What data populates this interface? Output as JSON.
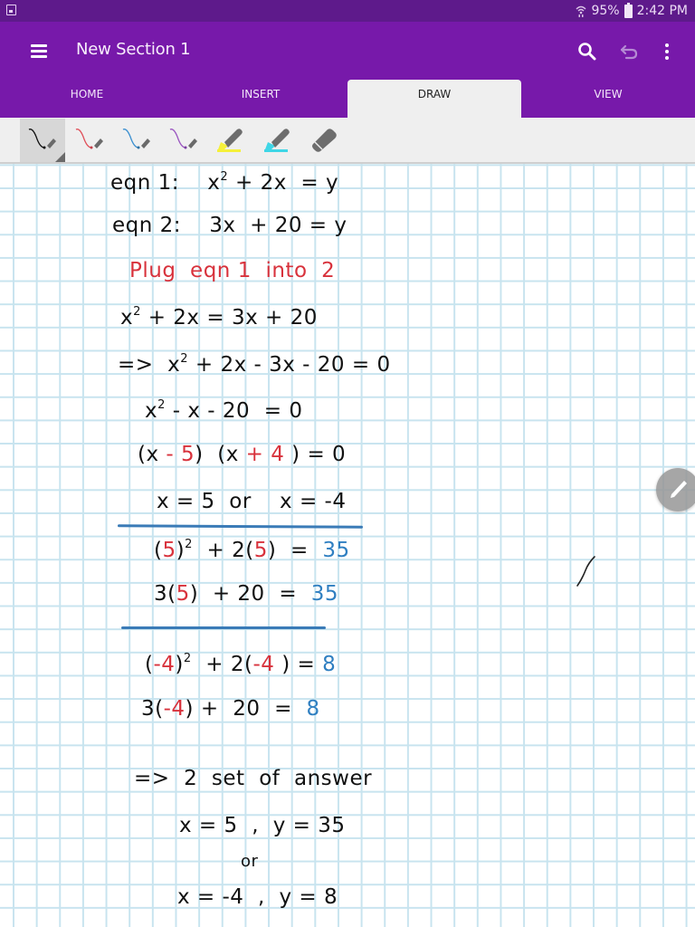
{
  "status_bar": {
    "notification_icon": "gallery-icon",
    "signal_icon": "wifi-icon",
    "battery_percent": "95%",
    "battery_icon": "battery-icon",
    "time": "2:42 PM"
  },
  "app_bar": {
    "menu_icon": "hamburger-menu-icon",
    "title": "New Section 1",
    "actions": [
      {
        "name": "search",
        "icon": "search-icon"
      },
      {
        "name": "undo",
        "icon": "undo-icon",
        "enabled": false
      },
      {
        "name": "more",
        "icon": "more-vertical-icon"
      }
    ]
  },
  "tabs": [
    {
      "label": "HOME",
      "active": false
    },
    {
      "label": "INSERT",
      "active": false
    },
    {
      "label": "DRAW",
      "active": true
    },
    {
      "label": "VIEW",
      "active": false
    }
  ],
  "draw_tools": [
    {
      "name": "pen-black",
      "type": "pen",
      "color": "#111111",
      "selected": true
    },
    {
      "name": "pen-red",
      "type": "pen",
      "color": "#e0505a",
      "selected": false
    },
    {
      "name": "pen-blue",
      "type": "pen",
      "color": "#3a8fd0",
      "selected": false
    },
    {
      "name": "pen-purple",
      "type": "pen",
      "color": "#9a55c0",
      "selected": false
    },
    {
      "name": "highlighter-yellow",
      "type": "highlighter",
      "color": "#f5f03a",
      "selected": false
    },
    {
      "name": "highlighter-cyan",
      "type": "highlighter",
      "color": "#3fd6e6",
      "selected": false
    },
    {
      "name": "eraser",
      "type": "eraser",
      "color": "#6d6d6d",
      "selected": false
    }
  ],
  "colors": {
    "ink_black": "#111111",
    "ink_red": "#d8323c",
    "ink_blue": "#2f7fc1",
    "divider_blue": "#3a7bb7",
    "grid": "#c8e4ef",
    "brand_purple": "#7719aa",
    "status_purple": "#5e1a8b"
  },
  "notes": {
    "lines": [
      {
        "segments": [
          {
            "t": "eqn 1:    x",
            "c": "black"
          },
          {
            "t": "2",
            "c": "black",
            "sup": true
          },
          {
            "t": " + 2x  = y",
            "c": "black"
          }
        ]
      },
      {
        "segments": [
          {
            "t": "eqn 2:    3x  + 20 = y",
            "c": "black"
          }
        ]
      },
      {
        "segments": [
          {
            "t": "Plug  eqn 1  into  2",
            "c": "red"
          }
        ]
      },
      {
        "segments": [
          {
            "t": "x",
            "c": "black"
          },
          {
            "t": "2",
            "c": "black",
            "sup": true
          },
          {
            "t": " + 2x = 3x + 20",
            "c": "black"
          }
        ]
      },
      {
        "segments": [
          {
            "t": "=>  x",
            "c": "black"
          },
          {
            "t": "2",
            "c": "black",
            "sup": true
          },
          {
            "t": " + 2x - 3x - 20 = 0",
            "c": "black"
          }
        ]
      },
      {
        "segments": [
          {
            "t": "x",
            "c": "black"
          },
          {
            "t": "2",
            "c": "black",
            "sup": true
          },
          {
            "t": " - x - 20  = 0",
            "c": "black"
          }
        ]
      },
      {
        "segments": [
          {
            "t": "(x",
            "c": "black"
          },
          {
            "t": " - 5",
            "c": "red"
          },
          {
            "t": ")  (x",
            "c": "black"
          },
          {
            "t": " + 4",
            "c": "red"
          },
          {
            "t": " ) = 0",
            "c": "black"
          }
        ]
      },
      {
        "segments": [
          {
            "t": "x = 5  or    x = -4",
            "c": "black"
          }
        ]
      },
      {
        "segments": [
          {
            "t": "(",
            "c": "black"
          },
          {
            "t": "5",
            "c": "red"
          },
          {
            "t": ")",
            "c": "black"
          },
          {
            "t": "2",
            "c": "black",
            "sup": true
          },
          {
            "t": "  + 2(",
            "c": "black"
          },
          {
            "t": "5",
            "c": "red"
          },
          {
            "t": ")  =  ",
            "c": "black"
          },
          {
            "t": "35",
            "c": "blue"
          }
        ]
      },
      {
        "segments": [
          {
            "t": "3(",
            "c": "black"
          },
          {
            "t": "5",
            "c": "red"
          },
          {
            "t": ")  + 20  =  ",
            "c": "black"
          },
          {
            "t": "35",
            "c": "blue"
          }
        ]
      },
      {
        "segments": [
          {
            "t": "(",
            "c": "black"
          },
          {
            "t": "-4",
            "c": "red"
          },
          {
            "t": ")",
            "c": "black"
          },
          {
            "t": "2",
            "c": "black",
            "sup": true
          },
          {
            "t": "  + 2(",
            "c": "black"
          },
          {
            "t": "-4",
            "c": "red"
          },
          {
            "t": " ) = ",
            "c": "black"
          },
          {
            "t": "8",
            "c": "blue"
          }
        ]
      },
      {
        "segments": [
          {
            "t": "3(",
            "c": "black"
          },
          {
            "t": "-4",
            "c": "red"
          },
          {
            "t": ") +  20  =  ",
            "c": "black"
          },
          {
            "t": "8",
            "c": "blue"
          }
        ]
      },
      {
        "segments": [
          {
            "t": "=>  2  set  of  answer",
            "c": "black"
          }
        ]
      },
      {
        "segments": [
          {
            "t": "x = 5  ,  y = 35",
            "c": "black"
          }
        ]
      },
      {
        "segments": [
          {
            "t": "or",
            "c": "black"
          }
        ]
      },
      {
        "segments": [
          {
            "t": "x = -4  ,  y = 8",
            "c": "black"
          }
        ]
      }
    ]
  },
  "floating_button": {
    "icon": "pen-icon",
    "label": "draw mode"
  }
}
